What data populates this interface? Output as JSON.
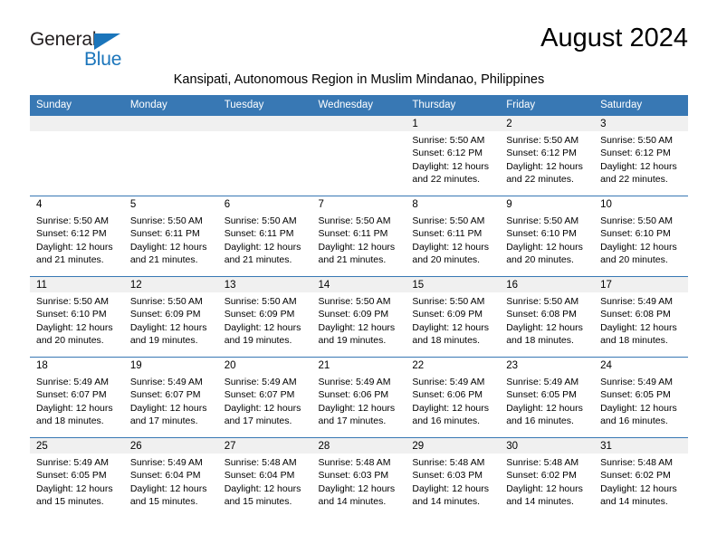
{
  "brand": {
    "name_dark": "General",
    "name_blue": "Blue",
    "accent_color": "#1b75bb",
    "header_color": "#3878b4"
  },
  "header": {
    "title": "August 2024",
    "subtitle": "Kansipati, Autonomous Region in Muslim Mindanao, Philippines"
  },
  "calendar": {
    "weekday_headers": [
      "Sunday",
      "Monday",
      "Tuesday",
      "Wednesday",
      "Thursday",
      "Friday",
      "Saturday"
    ],
    "weeks": [
      [
        {
          "day": "",
          "sunrise": "",
          "sunset": "",
          "daylight_line1": "",
          "daylight_line2": ""
        },
        {
          "day": "",
          "sunrise": "",
          "sunset": "",
          "daylight_line1": "",
          "daylight_line2": ""
        },
        {
          "day": "",
          "sunrise": "",
          "sunset": "",
          "daylight_line1": "",
          "daylight_line2": ""
        },
        {
          "day": "",
          "sunrise": "",
          "sunset": "",
          "daylight_line1": "",
          "daylight_line2": ""
        },
        {
          "day": "1",
          "sunrise": "Sunrise: 5:50 AM",
          "sunset": "Sunset: 6:12 PM",
          "daylight_line1": "Daylight: 12 hours",
          "daylight_line2": "and 22 minutes."
        },
        {
          "day": "2",
          "sunrise": "Sunrise: 5:50 AM",
          "sunset": "Sunset: 6:12 PM",
          "daylight_line1": "Daylight: 12 hours",
          "daylight_line2": "and 22 minutes."
        },
        {
          "day": "3",
          "sunrise": "Sunrise: 5:50 AM",
          "sunset": "Sunset: 6:12 PM",
          "daylight_line1": "Daylight: 12 hours",
          "daylight_line2": "and 22 minutes."
        }
      ],
      [
        {
          "day": "4",
          "sunrise": "Sunrise: 5:50 AM",
          "sunset": "Sunset: 6:12 PM",
          "daylight_line1": "Daylight: 12 hours",
          "daylight_line2": "and 21 minutes."
        },
        {
          "day": "5",
          "sunrise": "Sunrise: 5:50 AM",
          "sunset": "Sunset: 6:11 PM",
          "daylight_line1": "Daylight: 12 hours",
          "daylight_line2": "and 21 minutes."
        },
        {
          "day": "6",
          "sunrise": "Sunrise: 5:50 AM",
          "sunset": "Sunset: 6:11 PM",
          "daylight_line1": "Daylight: 12 hours",
          "daylight_line2": "and 21 minutes."
        },
        {
          "day": "7",
          "sunrise": "Sunrise: 5:50 AM",
          "sunset": "Sunset: 6:11 PM",
          "daylight_line1": "Daylight: 12 hours",
          "daylight_line2": "and 21 minutes."
        },
        {
          "day": "8",
          "sunrise": "Sunrise: 5:50 AM",
          "sunset": "Sunset: 6:11 PM",
          "daylight_line1": "Daylight: 12 hours",
          "daylight_line2": "and 20 minutes."
        },
        {
          "day": "9",
          "sunrise": "Sunrise: 5:50 AM",
          "sunset": "Sunset: 6:10 PM",
          "daylight_line1": "Daylight: 12 hours",
          "daylight_line2": "and 20 minutes."
        },
        {
          "day": "10",
          "sunrise": "Sunrise: 5:50 AM",
          "sunset": "Sunset: 6:10 PM",
          "daylight_line1": "Daylight: 12 hours",
          "daylight_line2": "and 20 minutes."
        }
      ],
      [
        {
          "day": "11",
          "sunrise": "Sunrise: 5:50 AM",
          "sunset": "Sunset: 6:10 PM",
          "daylight_line1": "Daylight: 12 hours",
          "daylight_line2": "and 20 minutes."
        },
        {
          "day": "12",
          "sunrise": "Sunrise: 5:50 AM",
          "sunset": "Sunset: 6:09 PM",
          "daylight_line1": "Daylight: 12 hours",
          "daylight_line2": "and 19 minutes."
        },
        {
          "day": "13",
          "sunrise": "Sunrise: 5:50 AM",
          "sunset": "Sunset: 6:09 PM",
          "daylight_line1": "Daylight: 12 hours",
          "daylight_line2": "and 19 minutes."
        },
        {
          "day": "14",
          "sunrise": "Sunrise: 5:50 AM",
          "sunset": "Sunset: 6:09 PM",
          "daylight_line1": "Daylight: 12 hours",
          "daylight_line2": "and 19 minutes."
        },
        {
          "day": "15",
          "sunrise": "Sunrise: 5:50 AM",
          "sunset": "Sunset: 6:09 PM",
          "daylight_line1": "Daylight: 12 hours",
          "daylight_line2": "and 18 minutes."
        },
        {
          "day": "16",
          "sunrise": "Sunrise: 5:50 AM",
          "sunset": "Sunset: 6:08 PM",
          "daylight_line1": "Daylight: 12 hours",
          "daylight_line2": "and 18 minutes."
        },
        {
          "day": "17",
          "sunrise": "Sunrise: 5:49 AM",
          "sunset": "Sunset: 6:08 PM",
          "daylight_line1": "Daylight: 12 hours",
          "daylight_line2": "and 18 minutes."
        }
      ],
      [
        {
          "day": "18",
          "sunrise": "Sunrise: 5:49 AM",
          "sunset": "Sunset: 6:07 PM",
          "daylight_line1": "Daylight: 12 hours",
          "daylight_line2": "and 18 minutes."
        },
        {
          "day": "19",
          "sunrise": "Sunrise: 5:49 AM",
          "sunset": "Sunset: 6:07 PM",
          "daylight_line1": "Daylight: 12 hours",
          "daylight_line2": "and 17 minutes."
        },
        {
          "day": "20",
          "sunrise": "Sunrise: 5:49 AM",
          "sunset": "Sunset: 6:07 PM",
          "daylight_line1": "Daylight: 12 hours",
          "daylight_line2": "and 17 minutes."
        },
        {
          "day": "21",
          "sunrise": "Sunrise: 5:49 AM",
          "sunset": "Sunset: 6:06 PM",
          "daylight_line1": "Daylight: 12 hours",
          "daylight_line2": "and 17 minutes."
        },
        {
          "day": "22",
          "sunrise": "Sunrise: 5:49 AM",
          "sunset": "Sunset: 6:06 PM",
          "daylight_line1": "Daylight: 12 hours",
          "daylight_line2": "and 16 minutes."
        },
        {
          "day": "23",
          "sunrise": "Sunrise: 5:49 AM",
          "sunset": "Sunset: 6:05 PM",
          "daylight_line1": "Daylight: 12 hours",
          "daylight_line2": "and 16 minutes."
        },
        {
          "day": "24",
          "sunrise": "Sunrise: 5:49 AM",
          "sunset": "Sunset: 6:05 PM",
          "daylight_line1": "Daylight: 12 hours",
          "daylight_line2": "and 16 minutes."
        }
      ],
      [
        {
          "day": "25",
          "sunrise": "Sunrise: 5:49 AM",
          "sunset": "Sunset: 6:05 PM",
          "daylight_line1": "Daylight: 12 hours",
          "daylight_line2": "and 15 minutes."
        },
        {
          "day": "26",
          "sunrise": "Sunrise: 5:49 AM",
          "sunset": "Sunset: 6:04 PM",
          "daylight_line1": "Daylight: 12 hours",
          "daylight_line2": "and 15 minutes."
        },
        {
          "day": "27",
          "sunrise": "Sunrise: 5:48 AM",
          "sunset": "Sunset: 6:04 PM",
          "daylight_line1": "Daylight: 12 hours",
          "daylight_line2": "and 15 minutes."
        },
        {
          "day": "28",
          "sunrise": "Sunrise: 5:48 AM",
          "sunset": "Sunset: 6:03 PM",
          "daylight_line1": "Daylight: 12 hours",
          "daylight_line2": "and 14 minutes."
        },
        {
          "day": "29",
          "sunrise": "Sunrise: 5:48 AM",
          "sunset": "Sunset: 6:03 PM",
          "daylight_line1": "Daylight: 12 hours",
          "daylight_line2": "and 14 minutes."
        },
        {
          "day": "30",
          "sunrise": "Sunrise: 5:48 AM",
          "sunset": "Sunset: 6:02 PM",
          "daylight_line1": "Daylight: 12 hours",
          "daylight_line2": "and 14 minutes."
        },
        {
          "day": "31",
          "sunrise": "Sunrise: 5:48 AM",
          "sunset": "Sunset: 6:02 PM",
          "daylight_line1": "Daylight: 12 hours",
          "daylight_line2": "and 14 minutes."
        }
      ]
    ]
  }
}
